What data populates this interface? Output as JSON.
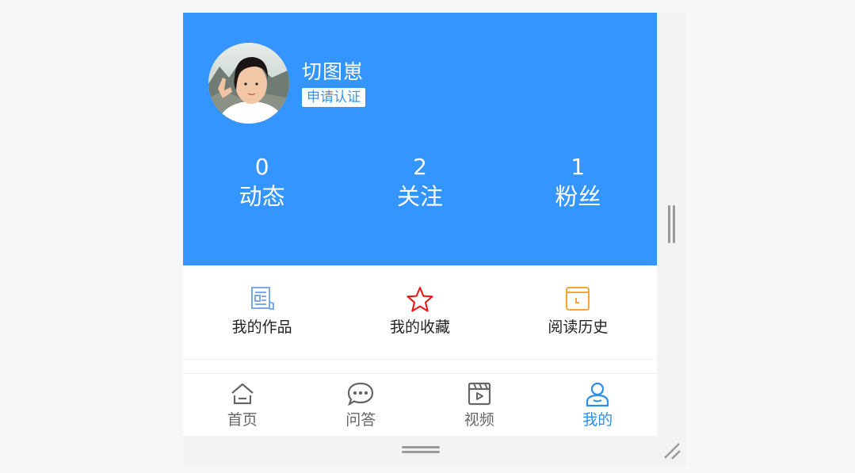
{
  "profile": {
    "username": "切图崽",
    "verify_label": "申请认证"
  },
  "stats": [
    {
      "value": "0",
      "label": "动态"
    },
    {
      "value": "2",
      "label": "关注"
    },
    {
      "value": "1",
      "label": "粉丝"
    }
  ],
  "shortcuts": [
    {
      "label": "我的作品",
      "icon": "document-icon",
      "color": "#7aa7ee"
    },
    {
      "label": "我的收藏",
      "icon": "star-icon",
      "color": "#ee1111"
    },
    {
      "label": "阅读历史",
      "icon": "history-icon",
      "color": "#f4a43a"
    }
  ],
  "tabbar": {
    "items": [
      {
        "label": "首页",
        "icon": "home-icon"
      },
      {
        "label": "问答",
        "icon": "chat-icon"
      },
      {
        "label": "视频",
        "icon": "video-icon"
      },
      {
        "label": "我的",
        "icon": "user-icon"
      }
    ],
    "active": "我的",
    "active_color": "#2d8cf0"
  },
  "colors": {
    "header_bg": "#3595ff",
    "accent": "#2d8cf0"
  }
}
